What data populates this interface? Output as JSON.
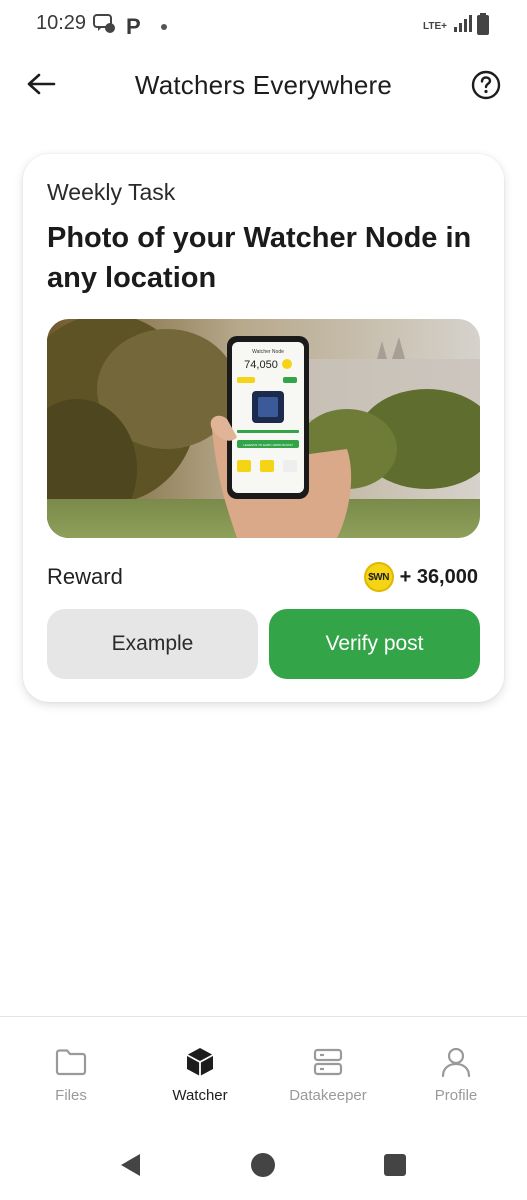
{
  "status_bar": {
    "time": "10:29",
    "network": "LTE+"
  },
  "header": {
    "title": "Watchers Everywhere",
    "back_icon": "arrow-left-icon",
    "help_icon": "question-circle-icon"
  },
  "task": {
    "label": "Weekly Task",
    "title": "Photo of your Watcher Node in any location",
    "image_phone": {
      "app_title": "Watcher Node",
      "balance": "74,050",
      "banner": "LEGENDS TO EARN 1000% BOOST"
    },
    "reward_label": "Reward",
    "reward_coin": "$WN",
    "reward_value": "+ 36,000",
    "example_button": "Example",
    "verify_button": "Verify post"
  },
  "bottom_nav": {
    "items": [
      {
        "label": "Files",
        "icon": "folder-icon",
        "active": false
      },
      {
        "label": "Watcher",
        "icon": "cube-icon",
        "active": true
      },
      {
        "label": "Datakeeper",
        "icon": "server-icon",
        "active": false
      },
      {
        "label": "Profile",
        "icon": "user-icon",
        "active": false
      }
    ]
  },
  "colors": {
    "accent_green": "#33a447",
    "coin_yellow": "#f5d315",
    "inactive_gray": "#9a9a9a"
  }
}
